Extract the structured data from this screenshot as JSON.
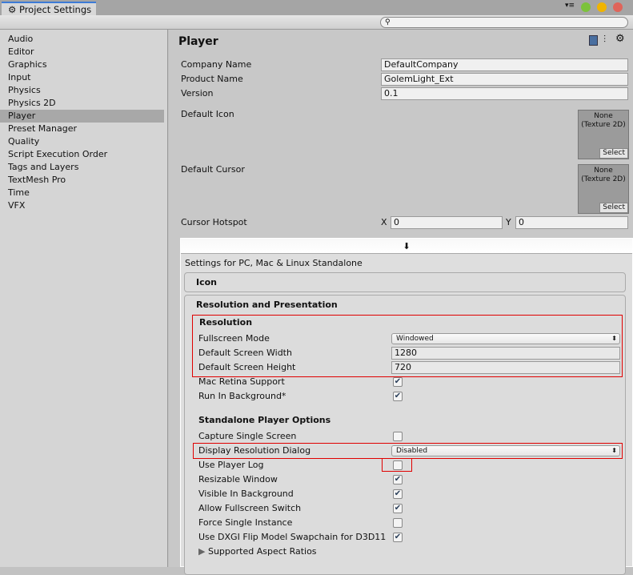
{
  "window": {
    "tab_title": "Project Settings",
    "search_placeholder": ""
  },
  "sidebar": {
    "items": [
      "Audio",
      "Editor",
      "Graphics",
      "Input",
      "Physics",
      "Physics 2D",
      "Player",
      "Preset Manager",
      "Quality",
      "Script Execution Order",
      "Tags and Layers",
      "TextMesh Pro",
      "Time",
      "VFX"
    ],
    "selected": "Player"
  },
  "main": {
    "title": "Player",
    "company_label": "Company Name",
    "company_value": "DefaultCompany",
    "product_label": "Product Name",
    "product_value": "GolemLight_Ext",
    "version_label": "Version",
    "version_value": "0.1",
    "default_icon_label": "Default Icon",
    "default_cursor_label": "Default Cursor",
    "texture_none": "None",
    "texture_type": "(Texture 2D)",
    "select_label": "Select",
    "hotspot_label": "Cursor Hotspot",
    "x_label": "X",
    "x_value": "0",
    "y_label": "Y",
    "y_value": "0"
  },
  "platform": {
    "heading": "Settings for PC, Mac & Linux Standalone",
    "icon_section": "Icon",
    "res_section": "Resolution and Presentation",
    "resolution_heading": "Resolution",
    "fullscreen_label": "Fullscreen Mode",
    "fullscreen_value": "Windowed",
    "width_label": "Default Screen Width",
    "width_value": "1280",
    "height_label": "Default Screen Height",
    "height_value": "720",
    "retina_label": "Mac Retina Support",
    "background_label": "Run In Background*",
    "standalone_heading": "Standalone Player Options",
    "capture_label": "Capture Single Screen",
    "dialog_label": "Display Resolution Dialog",
    "dialog_value": "Disabled",
    "log_label": "Use Player Log",
    "resizable_label": "Resizable Window",
    "visible_label": "Visible In Background",
    "fullswitch_label": "Allow Fullscreen Switch",
    "single_label": "Force Single Instance",
    "dxgi_label": "Use DXGI Flip Model Swapchain for D3D11",
    "aspect_label": "Supported Aspect Ratios",
    "checks": {
      "retina": true,
      "background": true,
      "capture": false,
      "log": false,
      "resizable": true,
      "visible": true,
      "fullswitch": true,
      "single": false,
      "dxgi": true
    }
  }
}
